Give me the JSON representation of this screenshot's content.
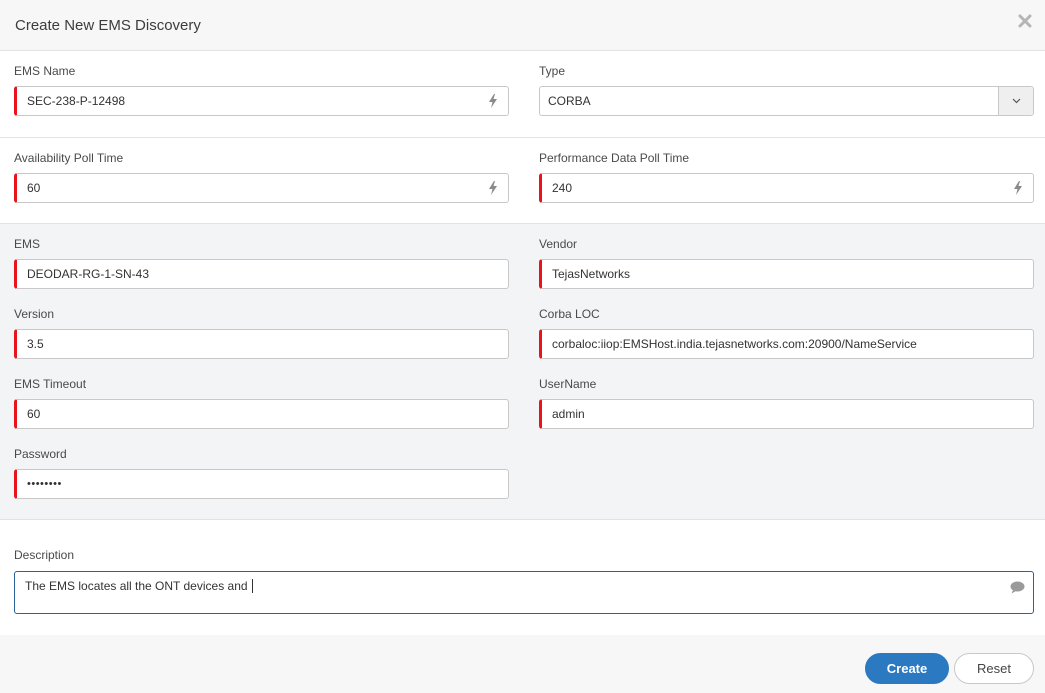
{
  "dialog": {
    "title": "Create New EMS Discovery",
    "close_icon": "close-x-icon"
  },
  "section1": {
    "ems_name": {
      "label": "EMS Name",
      "value": "SEC-238-P-12498",
      "required": true,
      "icon": "bolt-icon"
    },
    "type": {
      "label": "Type",
      "value": "CORBA",
      "icon": "chevron-down-icon"
    }
  },
  "section2": {
    "availability_poll_time": {
      "label": "Availability Poll Time",
      "value": "60",
      "required": true,
      "icon": "bolt-icon"
    },
    "performance_poll_time": {
      "label": "Performance Data Poll Time",
      "value": "240",
      "required": true,
      "icon": "bolt-icon"
    }
  },
  "section3": {
    "ems": {
      "label": "EMS",
      "value": "DEODAR-RG-1-SN-43",
      "required": true
    },
    "vendor": {
      "label": "Vendor",
      "value": "TejasNetworks",
      "required": true
    },
    "version": {
      "label": "Version",
      "value": "3.5",
      "required": true
    },
    "corba_loc": {
      "label": "Corba LOC",
      "value": "corbaloc:iiop:EMSHost.india.tejasnetworks.com:20900/NameService",
      "required": true
    },
    "ems_timeout": {
      "label": "EMS Timeout",
      "value": "60",
      "required": true
    },
    "username": {
      "label": "UserName",
      "value": "admin",
      "required": true
    },
    "password": {
      "label": "Password",
      "value": "••••••••",
      "required": true
    }
  },
  "description": {
    "label": "Description",
    "value": "The EMS locates all the ONT devices and ",
    "icon": "comment-icon"
  },
  "footer": {
    "create_label": "Create",
    "reset_label": "Reset"
  },
  "colors": {
    "required_marker": "#e8141b",
    "primary_button": "#2a79c1",
    "focus_border": "#2a6496",
    "gray_section": "#f3f4f6"
  }
}
